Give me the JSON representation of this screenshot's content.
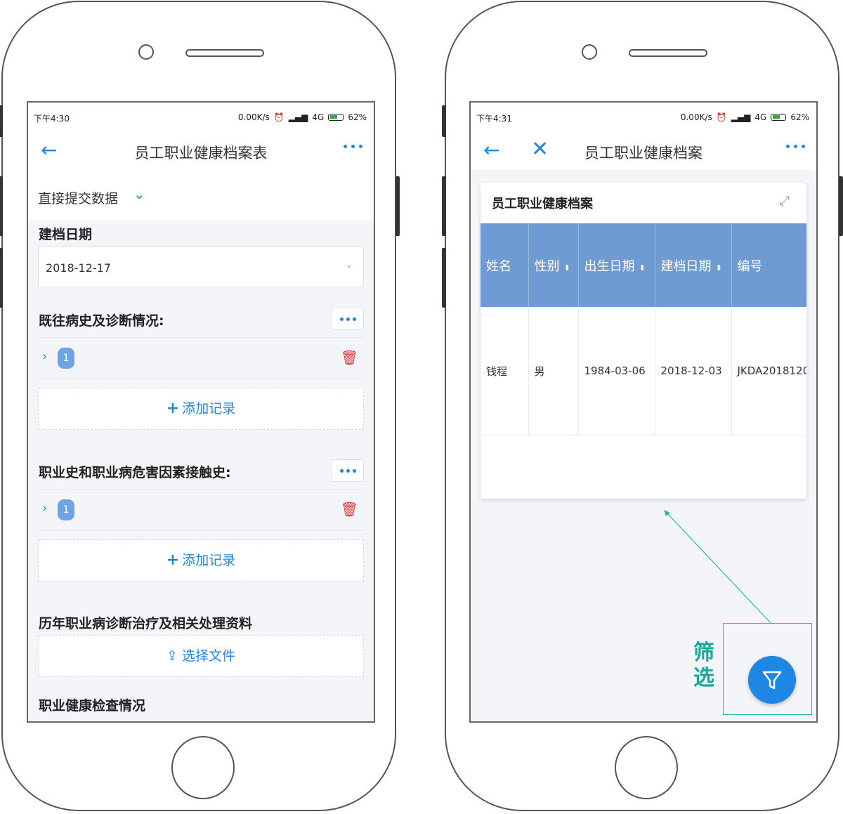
{
  "left_phone": {
    "status": {
      "time": "下午4:30",
      "net": "0.00K/s",
      "signal": "4G",
      "battery": "62%"
    },
    "nav": {
      "title": "员工职业健康档案表"
    },
    "submit_mode": "直接提交数据",
    "file_date": {
      "label": "建档日期",
      "value": "2018-12-17"
    },
    "sections": [
      {
        "label": "既往病史及诊断情况:",
        "badge": "1",
        "add_label": "添加记录"
      },
      {
        "label": "职业史和职业病危害因素接触史:",
        "badge": "1",
        "add_label": "添加记录"
      }
    ],
    "upload": {
      "label": "历年职业病诊断治疗及相关处理资料",
      "button": "选择文件"
    },
    "next_section": "职业健康检查情况"
  },
  "right_phone": {
    "status": {
      "time": "下午4:31",
      "net": "0.00K/s",
      "signal": "4G",
      "battery": "62%"
    },
    "nav": {
      "title": "员工职业健康档案"
    },
    "card": {
      "title": "员工职业健康档案",
      "columns": [
        "姓名",
        "性别",
        "出生日期",
        "建档日期",
        "编号"
      ],
      "rows": [
        [
          "钱程",
          "男",
          "1984-03-06",
          "2018-12-03",
          "JKDA2018120"
        ]
      ]
    }
  },
  "annotation": {
    "text1": "筛",
    "text2": "选",
    "color": "#19a99a"
  },
  "colors": {
    "accent": "#1e86e5",
    "header": "#6e9bd2",
    "delete": "#e43b3b"
  },
  "icons": [
    "back-arrow-icon",
    "close-icon",
    "more-icon",
    "chevron-down-icon",
    "trash-icon",
    "plus-icon",
    "upload-icon",
    "expand-icon",
    "filter-icon"
  ]
}
